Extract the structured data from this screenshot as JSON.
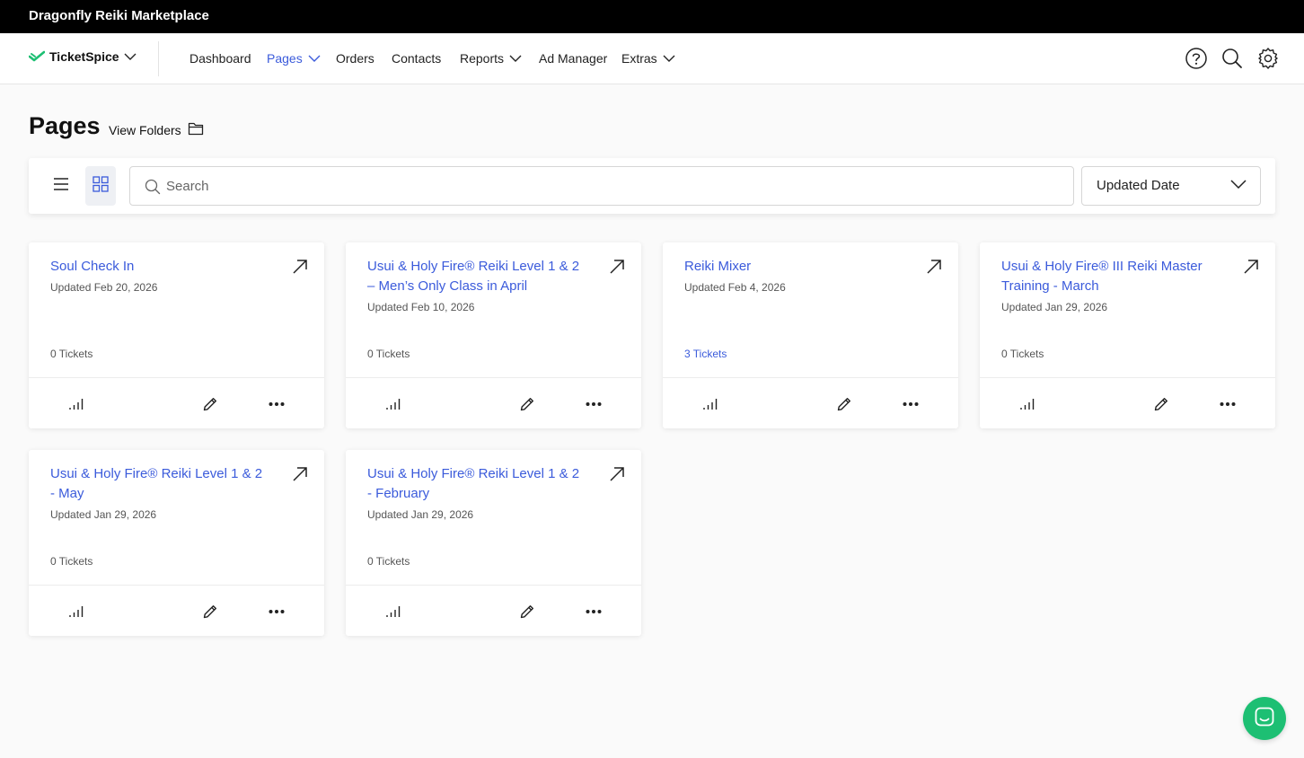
{
  "topbar": {
    "title": "Dragonfly Reiki Marketplace"
  },
  "nav": {
    "brand": "TicketSpice",
    "items": [
      {
        "label": "Dashboard"
      },
      {
        "label": "Pages"
      },
      {
        "label": "Orders"
      },
      {
        "label": "Contacts"
      },
      {
        "label": "Reports"
      },
      {
        "label": "Ad Manager"
      },
      {
        "label": "Extras"
      }
    ],
    "active_item": "Pages",
    "icons": [
      "help-icon",
      "search-icon",
      "gear-icon"
    ]
  },
  "page": {
    "title": "Pages",
    "view_folders": "View Folders"
  },
  "toolbar": {
    "search_placeholder": "Search",
    "sort_value": "Updated Date",
    "view_mode": "grid"
  },
  "cards": [
    {
      "title": "Soul Check In",
      "updated": "Updated Feb 20, 2026",
      "tickets": "0 Tickets"
    },
    {
      "title": "Usui & Holy Fire® Reiki Level 1 & 2 – Men’s Only Class in April",
      "updated": "Updated Feb 10, 2026",
      "tickets": "0 Tickets"
    },
    {
      "title": "Reiki Mixer",
      "updated": "Updated Feb 4, 2026",
      "tickets": "3 Tickets"
    },
    {
      "title": "Usui & Holy Fire® III Reiki Master Training - March",
      "updated": "Updated Jan 29, 2026",
      "tickets": "0 Tickets"
    },
    {
      "title": "Usui & Holy Fire® Reiki Level 1 & 2 - May",
      "updated": "Updated Jan 29, 2026",
      "tickets": "0 Tickets"
    },
    {
      "title": "Usui & Holy Fire® Reiki Level 1 & 2 - February",
      "updated": "Updated Jan 29, 2026",
      "tickets": "0 Tickets"
    }
  ],
  "colors": {
    "accent": "#3b5bdb",
    "brand_green": "#1dbf73",
    "topbar": "#000000"
  }
}
